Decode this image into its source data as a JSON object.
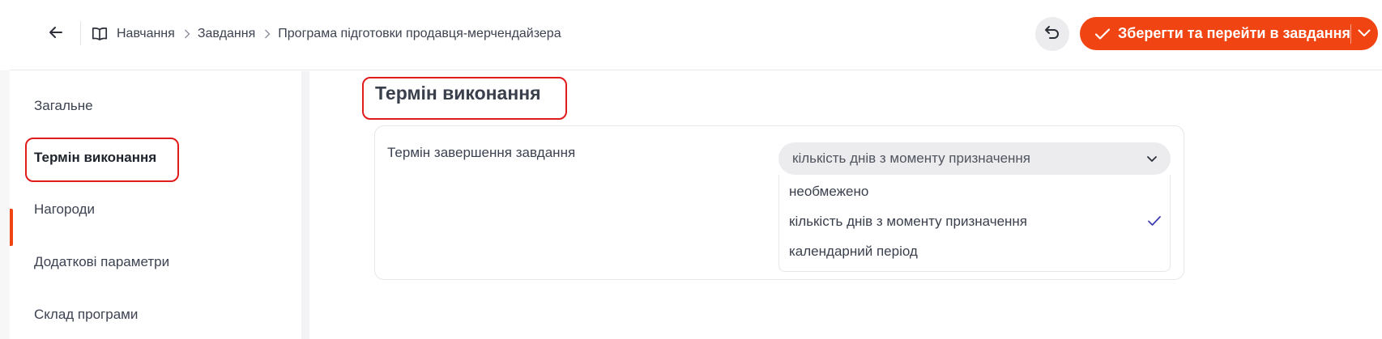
{
  "header": {
    "breadcrumb": [
      {
        "label": "Навчання"
      },
      {
        "label": "Завдання"
      },
      {
        "label": "Програма підготовки продавця-мерчендайзера"
      }
    ],
    "save_button_label": "Зберегти та перейти в завдання",
    "accent_color": "#f04412"
  },
  "sidebar": {
    "items": [
      {
        "label": "Загальне"
      },
      {
        "label": "Термін виконання",
        "active": true
      },
      {
        "label": "Нагороди"
      },
      {
        "label": "Додаткові параметри"
      },
      {
        "label": "Склад програми"
      }
    ]
  },
  "main": {
    "section_title": "Термін виконання",
    "field": {
      "label": "Термін завершення завдання",
      "selected_value": "кількість днів з моменту призначення",
      "options": [
        {
          "label": "необмежено",
          "selected": false
        },
        {
          "label": "кількість днів з моменту призначення",
          "selected": true
        },
        {
          "label": "календарний період",
          "selected": false
        }
      ]
    }
  }
}
